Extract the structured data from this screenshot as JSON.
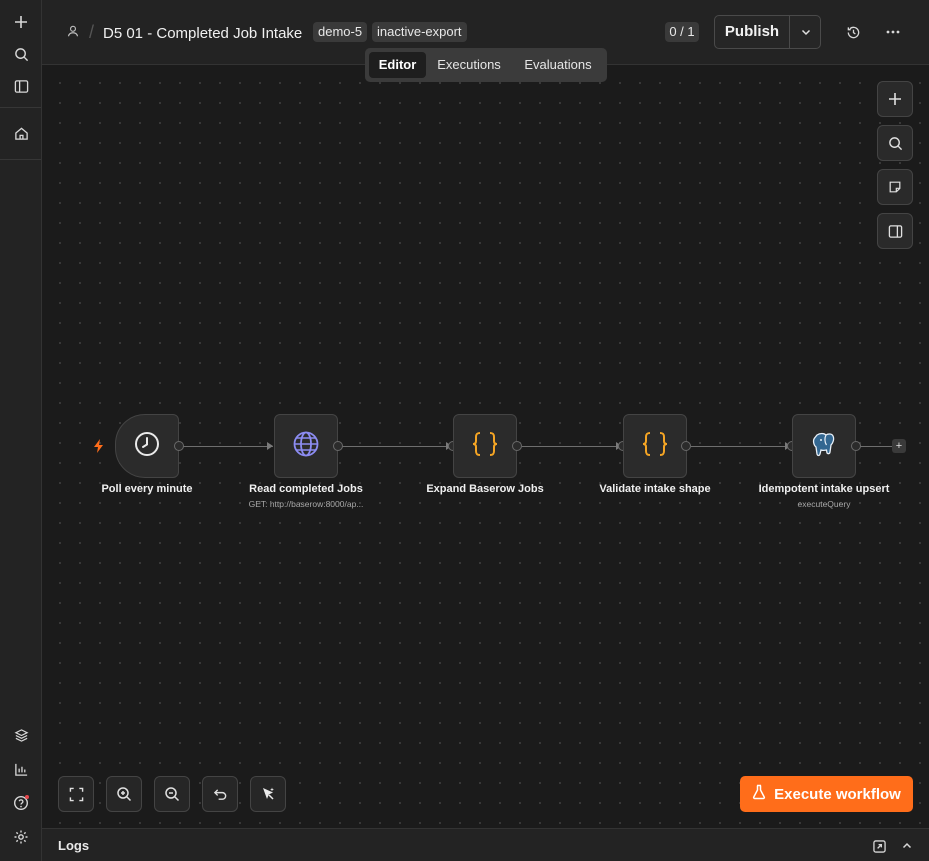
{
  "header": {
    "title": "D5 01 - Completed Job Intake",
    "tags": [
      "demo-5",
      "inactive-export"
    ],
    "counter": "0 / 1",
    "publish_label": "Publish"
  },
  "tabs": [
    {
      "label": "Editor",
      "active": true
    },
    {
      "label": "Executions",
      "active": false
    },
    {
      "label": "Evaluations",
      "active": false
    }
  ],
  "nodes": [
    {
      "label": "Poll every minute",
      "subtitle": "",
      "icon": "clock-icon"
    },
    {
      "label": "Read completed Jobs",
      "subtitle": "GET: http://baserow:8000/ap...",
      "icon": "globe-icon"
    },
    {
      "label": "Expand Baserow Jobs",
      "subtitle": "",
      "icon": "code-braces-icon"
    },
    {
      "label": "Validate intake shape",
      "subtitle": "",
      "icon": "code-braces-icon"
    },
    {
      "label": "Idempotent intake upsert",
      "subtitle": "executeQuery",
      "icon": "postgres-icon"
    }
  ],
  "execute_label": "Execute workflow",
  "logs_label": "Logs",
  "colors": {
    "accent": "#ff6d1a",
    "code_icon": "#f5a524",
    "globe_icon": "#8c8cf2",
    "trigger_bolt": "#ff6d1a"
  }
}
